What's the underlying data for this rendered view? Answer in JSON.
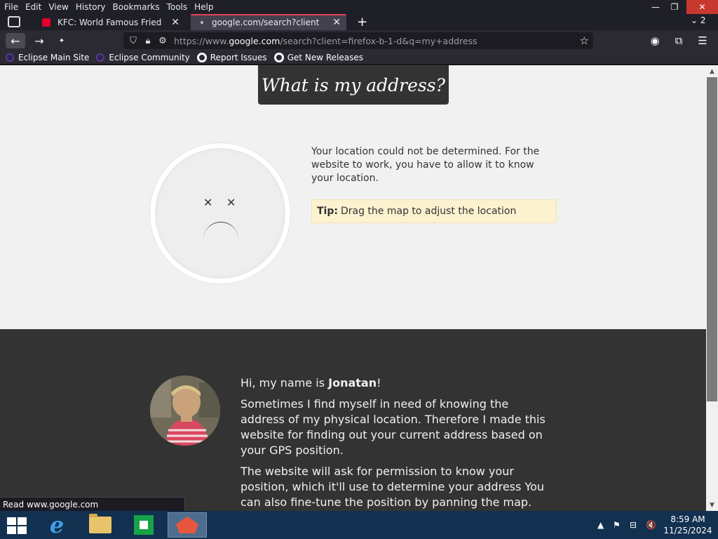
{
  "menubar": {
    "items": [
      "File",
      "Edit",
      "View",
      "History",
      "Bookmarks",
      "Tools",
      "Help"
    ]
  },
  "window_controls": {
    "minimize": "—",
    "maximize": "❐",
    "close": "✕"
  },
  "tabs": [
    {
      "title": "KFC: World Famous Fried Chick",
      "close": "✕"
    },
    {
      "title": "google.com/search?client=firef",
      "close": "✕"
    }
  ],
  "new_tab": "+",
  "tab_list": "⌄ 2",
  "nav": {
    "back": "←",
    "forward": "→",
    "reload": "✦",
    "url_prefix": "https://www.",
    "url_host": "google.com",
    "url_rest": "/search?client=firefox-b-1-d&q=my+address",
    "bookmark_star": "☆"
  },
  "bookmarks": [
    "Eclipse Main Site",
    "Eclipse Community",
    "Report Issues",
    "Get New Releases"
  ],
  "page": {
    "site_title": "What is my address?",
    "eye_left": "✕",
    "eye_right": "✕",
    "location_message": "Your location could not be determined. For the website to work, you have to allow it to know your location.",
    "tip_label": "Tip:",
    "tip_text": "Drag the map to adjust the location",
    "intro_prefix": "Hi, my name is ",
    "intro_name": "Jonatan",
    "intro_suffix": "!",
    "paragraph1": "Sometimes I find myself in need of knowing the address of my physical location. Therefore I made this website for finding out your current address based on your GPS position.",
    "paragraph2": "The website will ask for permission to know your position, which it'll use to determine your address You can also fine-tune the position by panning the map."
  },
  "status_bar": "Read www.google.com",
  "scrollbar": {
    "up": "▲",
    "down": "▼"
  },
  "taskbar": {
    "ie_glyph": "e",
    "tray_up": "▲",
    "tray_flag": "⚑",
    "tray_network": "⊟",
    "tray_volume": "🔇",
    "time": "8:59 AM",
    "date": "11/25/2024"
  },
  "colors": {
    "accent_tab": "#e4445a",
    "hero_bg": "#f1f1f1",
    "about_bg": "#333333",
    "tip_bg": "#fdf2cf",
    "taskbar": "#12304f"
  }
}
